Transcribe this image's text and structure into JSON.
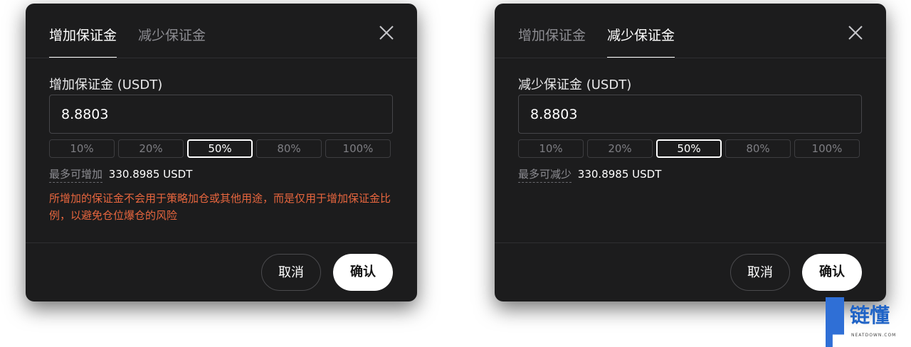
{
  "modals": [
    {
      "tabs": [
        {
          "label": "增加保证金",
          "active": true
        },
        {
          "label": "减少保证金",
          "active": false
        }
      ],
      "field_label": "增加保证金 (USDT)",
      "amount_value": "8.8803",
      "percent_options": [
        "10%",
        "20%",
        "50%",
        "80%",
        "100%"
      ],
      "selected_percent": "50%",
      "max_label": "最多可增加",
      "max_value": "330.8985 USDT",
      "warning": "所增加的保证金不会用于策略加仓或其他用途，而是仅用于增加保证金比例，以避免仓位爆仓的风险",
      "cancel_label": "取消",
      "confirm_label": "确认"
    },
    {
      "tabs": [
        {
          "label": "增加保证金",
          "active": false
        },
        {
          "label": "减少保证金",
          "active": true
        }
      ],
      "field_label": "减少保证金 (USDT)",
      "amount_value": "8.8803",
      "percent_options": [
        "10%",
        "20%",
        "50%",
        "80%",
        "100%"
      ],
      "selected_percent": "50%",
      "max_label": "最多可减少",
      "max_value": "330.8985 USDT",
      "cancel_label": "取消",
      "confirm_label": "确认"
    }
  ],
  "icons": {
    "close": "close-icon"
  },
  "colors": {
    "background": "#1c1c1d",
    "warning": "#e8663e",
    "accent": "#ffffff"
  },
  "watermark": {
    "text": "链懂",
    "sub": "NEATDOWN.COM"
  }
}
